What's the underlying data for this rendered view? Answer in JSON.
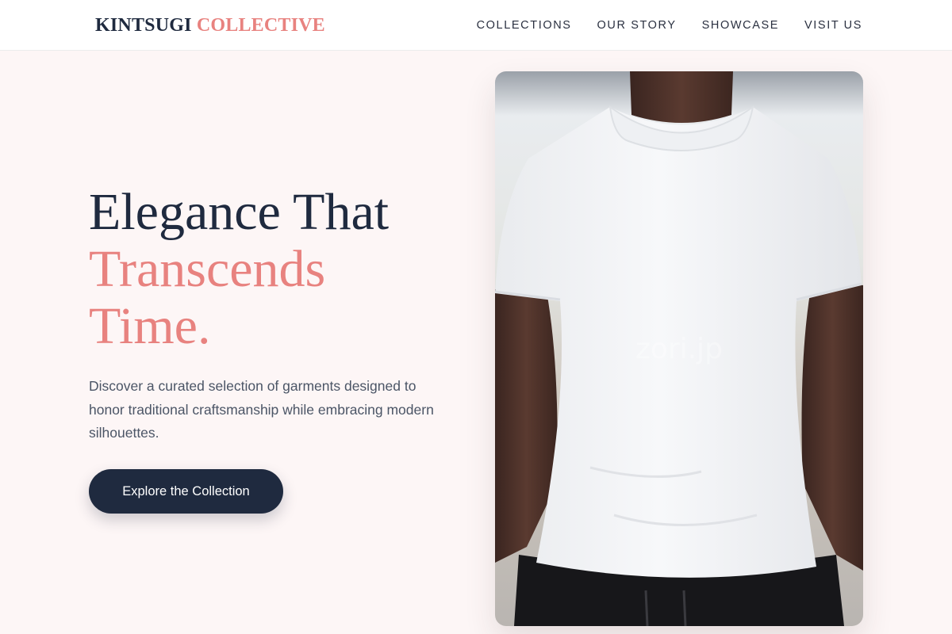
{
  "header": {
    "logo_primary": "KINTSUGI",
    "logo_accent": "COLLECTIVE",
    "nav": [
      "COLLECTIONS",
      "OUR STORY",
      "SHOWCASE",
      "VISIT US"
    ]
  },
  "hero": {
    "title_line1": "Elegance That",
    "title_line2": "Transcends",
    "title_line3": "Time.",
    "description": "Discover a curated selection of garments designed to honor traditional craftsmanship while embracing modern silhouettes.",
    "cta_label": "Explore the Collection"
  },
  "image": {
    "watermark": "zori.jp"
  },
  "colors": {
    "brand_dark": "#1f2a3f",
    "accent": "#e8827f",
    "background": "#fdf6f6"
  }
}
